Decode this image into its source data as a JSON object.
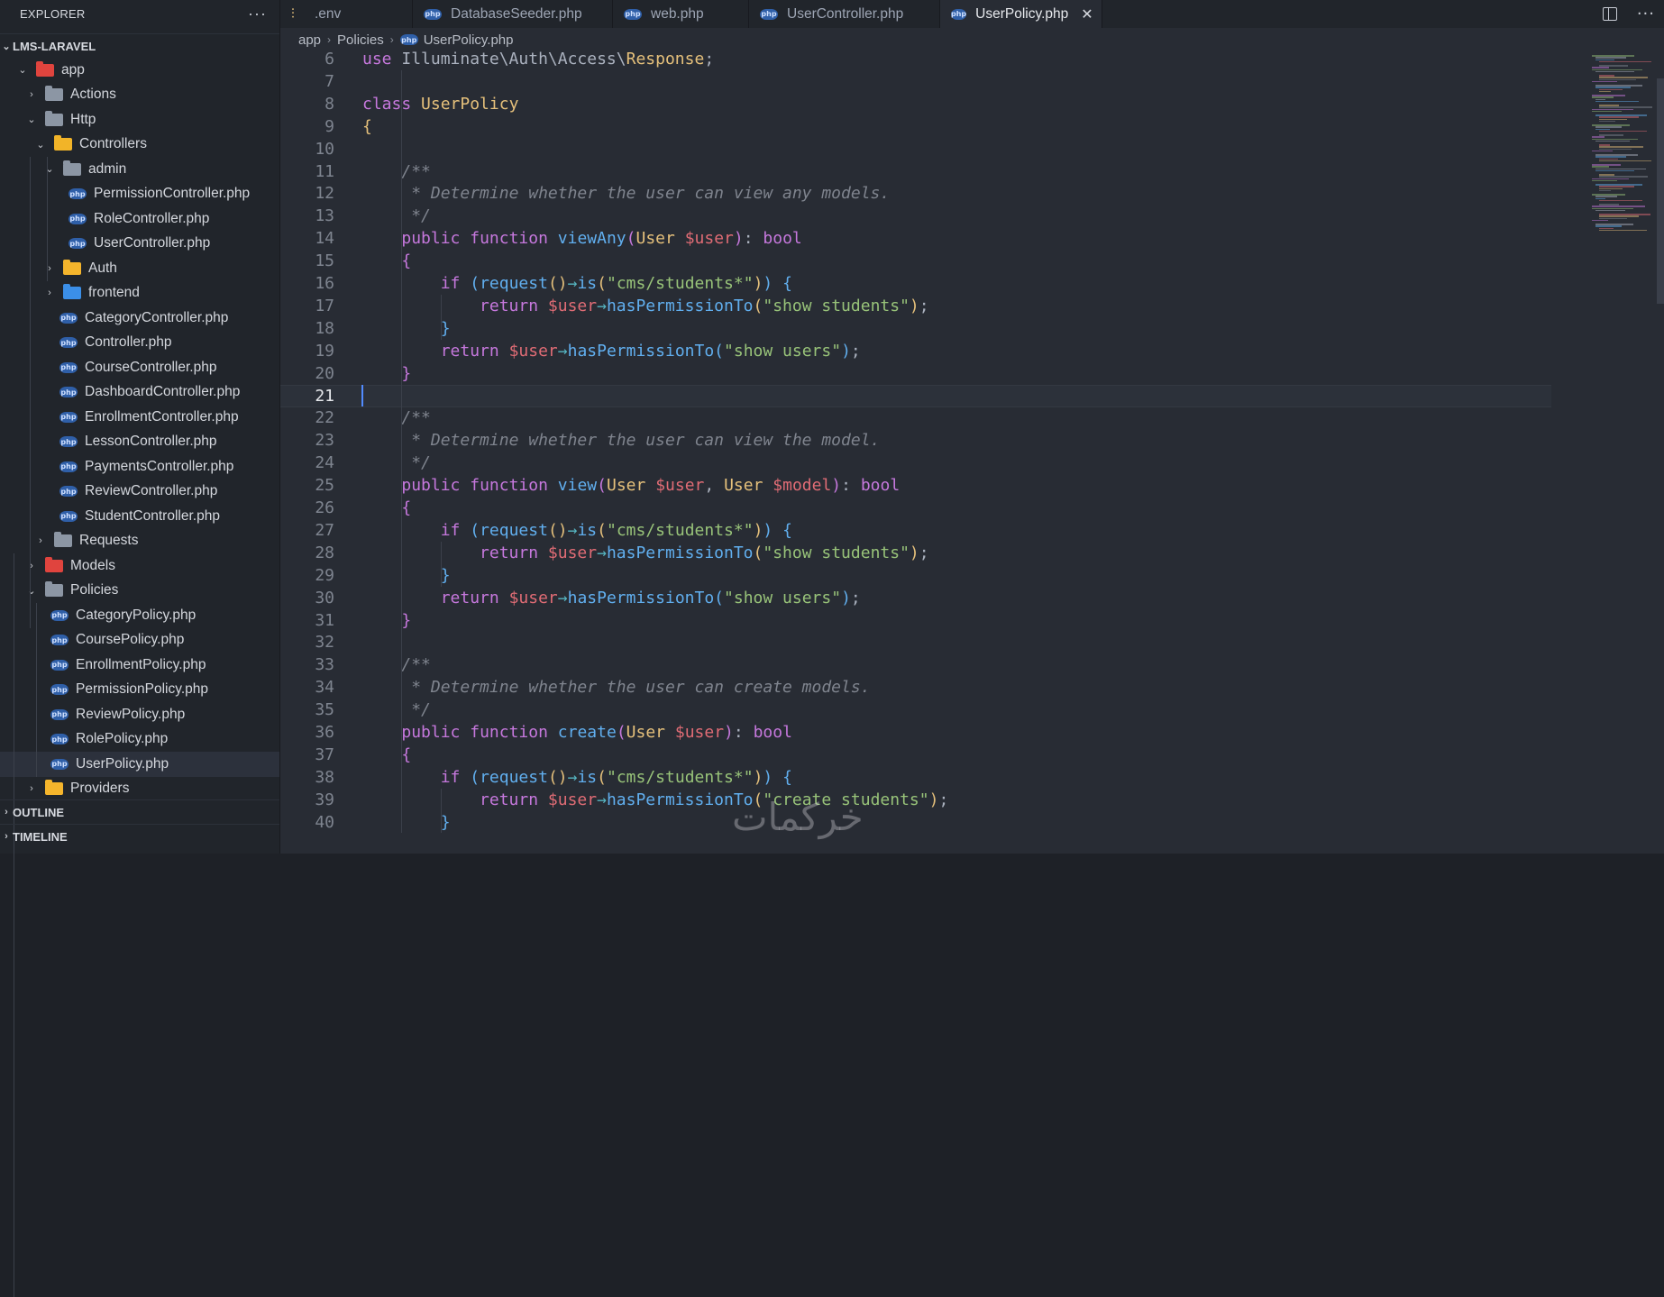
{
  "explorer": {
    "title": "EXPLORER",
    "more": "···",
    "root": "LMS-LARAVEL",
    "tree": [
      {
        "label": "app",
        "depth": 1,
        "type": "folder-app",
        "open": true
      },
      {
        "label": "Actions",
        "depth": 2,
        "type": "folder",
        "open": false
      },
      {
        "label": "Http",
        "depth": 2,
        "type": "folder",
        "open": true
      },
      {
        "label": "Controllers",
        "depth": 3,
        "type": "folder-controllers",
        "open": true
      },
      {
        "label": "admin",
        "depth": 4,
        "type": "folder-admin",
        "open": true
      },
      {
        "label": "PermissionController.php",
        "depth": 5,
        "type": "php"
      },
      {
        "label": "RoleController.php",
        "depth": 5,
        "type": "php"
      },
      {
        "label": "UserController.php",
        "depth": 5,
        "type": "php"
      },
      {
        "label": "Auth",
        "depth": 4,
        "type": "folder-auth",
        "open": false
      },
      {
        "label": "frontend",
        "depth": 4,
        "type": "folder-frontend",
        "open": false
      },
      {
        "label": "CategoryController.php",
        "depth": 4,
        "type": "php"
      },
      {
        "label": "Controller.php",
        "depth": 4,
        "type": "php"
      },
      {
        "label": "CourseController.php",
        "depth": 4,
        "type": "php"
      },
      {
        "label": "DashboardController.php",
        "depth": 4,
        "type": "php"
      },
      {
        "label": "EnrollmentController.php",
        "depth": 4,
        "type": "php"
      },
      {
        "label": "LessonController.php",
        "depth": 4,
        "type": "php"
      },
      {
        "label": "PaymentsController.php",
        "depth": 4,
        "type": "php"
      },
      {
        "label": "ReviewController.php",
        "depth": 4,
        "type": "php"
      },
      {
        "label": "StudentController.php",
        "depth": 4,
        "type": "php"
      },
      {
        "label": "Requests",
        "depth": 3,
        "type": "folder",
        "open": false
      },
      {
        "label": "Models",
        "depth": 2,
        "type": "folder-models",
        "open": false
      },
      {
        "label": "Policies",
        "depth": 2,
        "type": "folder",
        "open": true
      },
      {
        "label": "CategoryPolicy.php",
        "depth": 3,
        "type": "php"
      },
      {
        "label": "CoursePolicy.php",
        "depth": 3,
        "type": "php"
      },
      {
        "label": "EnrollmentPolicy.php",
        "depth": 3,
        "type": "php"
      },
      {
        "label": "PermissionPolicy.php",
        "depth": 3,
        "type": "php"
      },
      {
        "label": "ReviewPolicy.php",
        "depth": 3,
        "type": "php"
      },
      {
        "label": "RolePolicy.php",
        "depth": 3,
        "type": "php"
      },
      {
        "label": "UserPolicy.php",
        "depth": 3,
        "type": "php",
        "selected": true
      },
      {
        "label": "Providers",
        "depth": 2,
        "type": "folder-providers",
        "open": false
      }
    ],
    "outline": "OUTLINE",
    "timeline": "TIMELINE"
  },
  "tabs": [
    {
      "label": ".env",
      "icon": "env-icon"
    },
    {
      "label": "DatabaseSeeder.php",
      "icon": "php-icon"
    },
    {
      "label": "web.php",
      "icon": "php-icon"
    },
    {
      "label": "UserController.php",
      "icon": "php-icon"
    },
    {
      "label": "UserPolicy.php",
      "icon": "php-icon",
      "active": true
    }
  ],
  "breadcrumb": [
    "app",
    "Policies",
    "UserPolicy.php"
  ],
  "editor": {
    "current_line": 21,
    "lines": [
      {
        "n": 6,
        "tokens": [
          [
            "k",
            "use"
          ],
          [
            "t",
            " Illuminate\\Auth\\Access\\"
          ],
          [
            "c",
            "Response"
          ],
          [
            "t",
            ";"
          ]
        ]
      },
      {
        "n": 7,
        "tokens": []
      },
      {
        "n": 8,
        "tokens": [
          [
            "k",
            "class"
          ],
          [
            "t",
            " "
          ],
          [
            "c",
            "UserPolicy"
          ]
        ]
      },
      {
        "n": 9,
        "tokens": [
          [
            "p1",
            "{"
          ]
        ]
      },
      {
        "n": 10,
        "tokens": []
      },
      {
        "n": 11,
        "tokens": [
          [
            "t",
            "    "
          ],
          [
            "cm",
            "/**"
          ]
        ]
      },
      {
        "n": 12,
        "tokens": [
          [
            "t",
            "    "
          ],
          [
            "cm",
            " * Determine whether the user can view any models."
          ]
        ]
      },
      {
        "n": 13,
        "tokens": [
          [
            "t",
            "    "
          ],
          [
            "cm",
            " */"
          ]
        ]
      },
      {
        "n": 14,
        "tokens": [
          [
            "t",
            "    "
          ],
          [
            "k",
            "public"
          ],
          [
            "t",
            " "
          ],
          [
            "k",
            "function"
          ],
          [
            "t",
            " "
          ],
          [
            "f",
            "viewAny"
          ],
          [
            "p2",
            "("
          ],
          [
            "c",
            "User"
          ],
          [
            "t",
            " "
          ],
          [
            "v",
            "$user"
          ],
          [
            "p2",
            ")"
          ],
          [
            "t",
            ": "
          ],
          [
            "k",
            "bool"
          ]
        ]
      },
      {
        "n": 15,
        "tokens": [
          [
            "t",
            "    "
          ],
          [
            "p2",
            "{"
          ]
        ]
      },
      {
        "n": 16,
        "tokens": [
          [
            "t",
            "        "
          ],
          [
            "k",
            "if"
          ],
          [
            "t",
            " "
          ],
          [
            "p3",
            "("
          ],
          [
            "f",
            "request"
          ],
          [
            "p1",
            "()"
          ],
          [
            "ar",
            "→"
          ],
          [
            "f",
            "is"
          ],
          [
            "p1",
            "("
          ],
          [
            "s",
            "\"cms/students*\""
          ],
          [
            "p1",
            ")"
          ],
          [
            "p3",
            ")"
          ],
          [
            "t",
            " "
          ],
          [
            "p3",
            "{"
          ]
        ]
      },
      {
        "n": 17,
        "tokens": [
          [
            "t",
            "            "
          ],
          [
            "k",
            "return"
          ],
          [
            "t",
            " "
          ],
          [
            "v",
            "$user"
          ],
          [
            "ar",
            "→"
          ],
          [
            "f",
            "hasPermissionTo"
          ],
          [
            "p1",
            "("
          ],
          [
            "s",
            "\"show students\""
          ],
          [
            "p1",
            ")"
          ],
          [
            "t",
            ";"
          ]
        ]
      },
      {
        "n": 18,
        "tokens": [
          [
            "t",
            "        "
          ],
          [
            "p3",
            "}"
          ]
        ]
      },
      {
        "n": 19,
        "tokens": [
          [
            "t",
            "        "
          ],
          [
            "k",
            "return"
          ],
          [
            "t",
            " "
          ],
          [
            "v",
            "$user"
          ],
          [
            "ar",
            "→"
          ],
          [
            "f",
            "hasPermissionTo"
          ],
          [
            "p3",
            "("
          ],
          [
            "s",
            "\"show users\""
          ],
          [
            "p3",
            ")"
          ],
          [
            "t",
            ";"
          ]
        ]
      },
      {
        "n": 20,
        "tokens": [
          [
            "t",
            "    "
          ],
          [
            "p2",
            "}"
          ]
        ]
      },
      {
        "n": 21,
        "tokens": []
      },
      {
        "n": 22,
        "tokens": [
          [
            "t",
            "    "
          ],
          [
            "cm",
            "/**"
          ]
        ]
      },
      {
        "n": 23,
        "tokens": [
          [
            "t",
            "    "
          ],
          [
            "cm",
            " * Determine whether the user can view the model."
          ]
        ]
      },
      {
        "n": 24,
        "tokens": [
          [
            "t",
            "    "
          ],
          [
            "cm",
            " */"
          ]
        ]
      },
      {
        "n": 25,
        "tokens": [
          [
            "t",
            "    "
          ],
          [
            "k",
            "public"
          ],
          [
            "t",
            " "
          ],
          [
            "k",
            "function"
          ],
          [
            "t",
            " "
          ],
          [
            "f",
            "view"
          ],
          [
            "p2",
            "("
          ],
          [
            "c",
            "User"
          ],
          [
            "t",
            " "
          ],
          [
            "v",
            "$user"
          ],
          [
            "t",
            ", "
          ],
          [
            "c",
            "User"
          ],
          [
            "t",
            " "
          ],
          [
            "v",
            "$model"
          ],
          [
            "p2",
            ")"
          ],
          [
            "t",
            ": "
          ],
          [
            "k",
            "bool"
          ]
        ]
      },
      {
        "n": 26,
        "tokens": [
          [
            "t",
            "    "
          ],
          [
            "p2",
            "{"
          ]
        ]
      },
      {
        "n": 27,
        "tokens": [
          [
            "t",
            "        "
          ],
          [
            "k",
            "if"
          ],
          [
            "t",
            " "
          ],
          [
            "p3",
            "("
          ],
          [
            "f",
            "request"
          ],
          [
            "p1",
            "()"
          ],
          [
            "ar",
            "→"
          ],
          [
            "f",
            "is"
          ],
          [
            "p1",
            "("
          ],
          [
            "s",
            "\"cms/students*\""
          ],
          [
            "p1",
            ")"
          ],
          [
            "p3",
            ")"
          ],
          [
            "t",
            " "
          ],
          [
            "p3",
            "{"
          ]
        ]
      },
      {
        "n": 28,
        "tokens": [
          [
            "t",
            "            "
          ],
          [
            "k",
            "return"
          ],
          [
            "t",
            " "
          ],
          [
            "v",
            "$user"
          ],
          [
            "ar",
            "→"
          ],
          [
            "f",
            "hasPermissionTo"
          ],
          [
            "p1",
            "("
          ],
          [
            "s",
            "\"show students\""
          ],
          [
            "p1",
            ")"
          ],
          [
            "t",
            ";"
          ]
        ]
      },
      {
        "n": 29,
        "tokens": [
          [
            "t",
            "        "
          ],
          [
            "p3",
            "}"
          ]
        ]
      },
      {
        "n": 30,
        "tokens": [
          [
            "t",
            "        "
          ],
          [
            "k",
            "return"
          ],
          [
            "t",
            " "
          ],
          [
            "v",
            "$user"
          ],
          [
            "ar",
            "→"
          ],
          [
            "f",
            "hasPermissionTo"
          ],
          [
            "p3",
            "("
          ],
          [
            "s",
            "\"show users\""
          ],
          [
            "p3",
            ")"
          ],
          [
            "t",
            ";"
          ]
        ]
      },
      {
        "n": 31,
        "tokens": [
          [
            "t",
            "    "
          ],
          [
            "p2",
            "}"
          ]
        ]
      },
      {
        "n": 32,
        "tokens": []
      },
      {
        "n": 33,
        "tokens": [
          [
            "t",
            "    "
          ],
          [
            "cm",
            "/**"
          ]
        ]
      },
      {
        "n": 34,
        "tokens": [
          [
            "t",
            "    "
          ],
          [
            "cm",
            " * Determine whether the user can create models."
          ]
        ]
      },
      {
        "n": 35,
        "tokens": [
          [
            "t",
            "    "
          ],
          [
            "cm",
            " */"
          ]
        ]
      },
      {
        "n": 36,
        "tokens": [
          [
            "t",
            "    "
          ],
          [
            "k",
            "public"
          ],
          [
            "t",
            " "
          ],
          [
            "k",
            "function"
          ],
          [
            "t",
            " "
          ],
          [
            "f",
            "create"
          ],
          [
            "p2",
            "("
          ],
          [
            "c",
            "User"
          ],
          [
            "t",
            " "
          ],
          [
            "v",
            "$user"
          ],
          [
            "p2",
            ")"
          ],
          [
            "t",
            ": "
          ],
          [
            "k",
            "bool"
          ]
        ]
      },
      {
        "n": 37,
        "tokens": [
          [
            "t",
            "    "
          ],
          [
            "p2",
            "{"
          ]
        ]
      },
      {
        "n": 38,
        "tokens": [
          [
            "t",
            "        "
          ],
          [
            "k",
            "if"
          ],
          [
            "t",
            " "
          ],
          [
            "p3",
            "("
          ],
          [
            "f",
            "request"
          ],
          [
            "p1",
            "()"
          ],
          [
            "ar",
            "→"
          ],
          [
            "f",
            "is"
          ],
          [
            "p1",
            "("
          ],
          [
            "s",
            "\"cms/students*\""
          ],
          [
            "p1",
            ")"
          ],
          [
            "p3",
            ")"
          ],
          [
            "t",
            " "
          ],
          [
            "p3",
            "{"
          ]
        ]
      },
      {
        "n": 39,
        "tokens": [
          [
            "t",
            "            "
          ],
          [
            "k",
            "return"
          ],
          [
            "t",
            " "
          ],
          [
            "v",
            "$user"
          ],
          [
            "ar",
            "→"
          ],
          [
            "f",
            "hasPermissionTo"
          ],
          [
            "p1",
            "("
          ],
          [
            "s",
            "\"create students\""
          ],
          [
            "p1",
            ")"
          ],
          [
            "t",
            ";"
          ]
        ]
      },
      {
        "n": 40,
        "tokens": [
          [
            "t",
            "        "
          ],
          [
            "p3",
            "}"
          ]
        ]
      }
    ]
  },
  "watermark": "خرکمات"
}
